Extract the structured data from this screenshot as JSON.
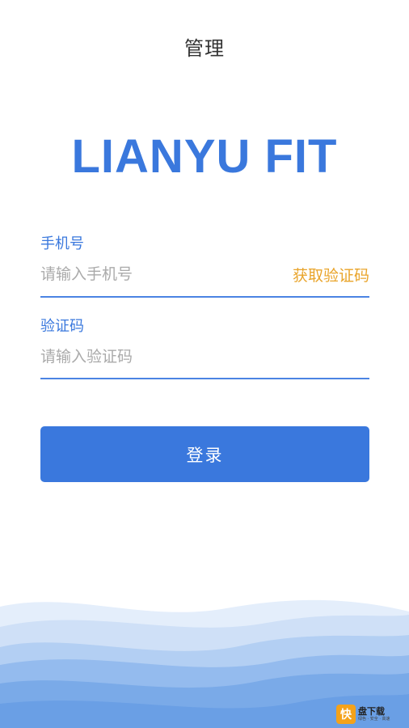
{
  "header": {
    "title": "管理"
  },
  "brand": {
    "name": "LIANYU FIT"
  },
  "form": {
    "phone": {
      "label": "手机号",
      "placeholder": "请输入手机号",
      "value": ""
    },
    "get_code_label": "获取验证码",
    "code": {
      "label": "验证码",
      "placeholder": "请输入验证码",
      "value": ""
    },
    "login_label": "登录"
  },
  "watermark": {
    "logo_glyph": "快",
    "main": "盘下载",
    "sub": "绿色 · 安全 · 高速"
  },
  "colors": {
    "accent": "#3a78dd",
    "link": "#e9a42a",
    "text": "#333333",
    "placeholder": "#aaaaaa"
  }
}
